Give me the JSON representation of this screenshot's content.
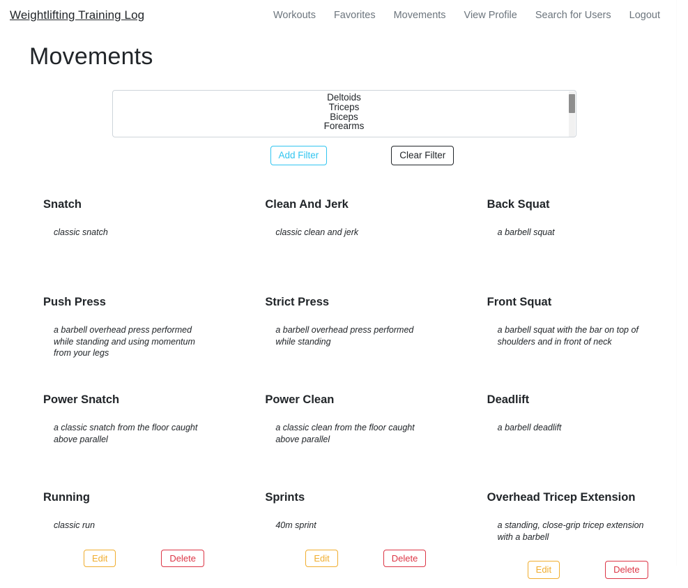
{
  "navbar": {
    "brand": "Weightlifting Training Log",
    "links": [
      {
        "label": "Workouts",
        "name": "nav-link-workouts"
      },
      {
        "label": "Favorites",
        "name": "nav-link-favorites"
      },
      {
        "label": "Movements",
        "name": "nav-link-movements"
      },
      {
        "label": "View Profile",
        "name": "nav-link-view-profile"
      },
      {
        "label": "Search for Users",
        "name": "nav-link-search-for-users"
      },
      {
        "label": "Logout",
        "name": "nav-link-logout"
      }
    ]
  },
  "page": {
    "title": "Movements"
  },
  "filter": {
    "options": [
      "Deltoids",
      "Triceps",
      "Biceps",
      "Forearms"
    ],
    "add_label": "Add Filter",
    "clear_label": "Clear Filter"
  },
  "actions": {
    "edit_label": "Edit",
    "delete_label": "Delete"
  },
  "colors": {
    "accent_add_filter": "#31c5f0",
    "edit": "#f0ad2e",
    "delete": "#dc3545",
    "nav_link": "#6c757d",
    "text": "#212529"
  },
  "movements": [
    {
      "title": "Snatch",
      "description": "classic snatch",
      "has_actions": false
    },
    {
      "title": "Clean And Jerk",
      "description": "classic clean and jerk",
      "has_actions": false
    },
    {
      "title": "Back Squat",
      "description": "a barbell squat",
      "has_actions": false
    },
    {
      "title": "Push Press",
      "description": "a barbell overhead press performed while standing and using momentum from your legs",
      "has_actions": false
    },
    {
      "title": "Strict Press",
      "description": "a barbell overhead press performed while standing",
      "has_actions": false
    },
    {
      "title": "Front Squat",
      "description": "a barbell squat with the bar on top of shoulders and in front of neck",
      "has_actions": false
    },
    {
      "title": "Power Snatch",
      "description": "a classic snatch from the floor caught above parallel",
      "has_actions": false
    },
    {
      "title": "Power Clean",
      "description": "a classic clean from the floor caught above parallel",
      "has_actions": false
    },
    {
      "title": "Deadlift",
      "description": "a barbell deadlift",
      "has_actions": false
    },
    {
      "title": "Running",
      "description": "classic run",
      "has_actions": true
    },
    {
      "title": "Sprints",
      "description": "40m sprint",
      "has_actions": true
    },
    {
      "title": "Overhead Tricep Extension",
      "description": "a standing, close-grip tricep extension with a barbell",
      "has_actions": true
    }
  ]
}
